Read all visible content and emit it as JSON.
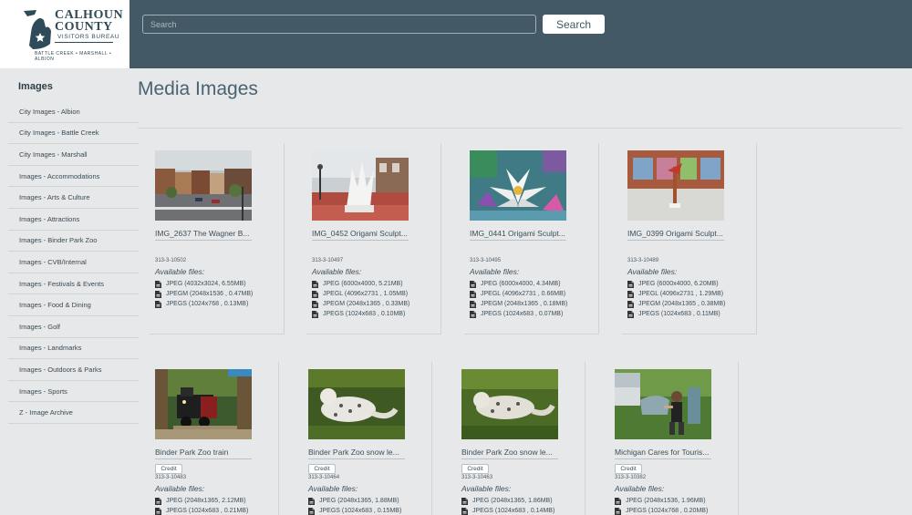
{
  "logo": {
    "line1": "CALHOUN",
    "line2": "COUNTY",
    "sub": "VISITORS BUREAU",
    "towns": "BATTLE CREEK • MARSHALL • ALBION"
  },
  "search": {
    "placeholder": "Search",
    "button_label": "Search"
  },
  "sidebar": {
    "heading": "Images",
    "items": [
      {
        "label": "City Images - Albion"
      },
      {
        "label": "City Images - Battle Creek"
      },
      {
        "label": "City Images - Marshall"
      },
      {
        "label": "Images - Accommodations"
      },
      {
        "label": "Images - Arts & Culture"
      },
      {
        "label": "Images - Attractions"
      },
      {
        "label": "Images - Binder Park Zoo"
      },
      {
        "label": "Images - CVB/Internal"
      },
      {
        "label": "Images - Festivals & Events"
      },
      {
        "label": "Images - Food & Dining"
      },
      {
        "label": "Images - Golf"
      },
      {
        "label": "Images - Landmarks"
      },
      {
        "label": "Images - Outdoors & Parks"
      },
      {
        "label": "Images - Sports"
      },
      {
        "label": "Z - Image Archive"
      }
    ]
  },
  "main": {
    "title": "Media Images",
    "available_label": "Available files:",
    "credit_label": "Credit",
    "icons": {
      "file": "file-icon"
    },
    "cards": [
      {
        "title": "IMG_2637 The Wagner B...",
        "id": "313-3-10502",
        "credit": false,
        "image": "street-scene",
        "files": [
          "JPEG (4032x3024, 6.55MB)",
          "JPEGM (2048x1536 , 0.47MB)",
          "JPEGS (1024x768 , 0.13MB)"
        ]
      },
      {
        "title": "IMG_0452 Origami Sculpt...",
        "id": "313-3-10497",
        "credit": false,
        "image": "white-sculpture",
        "files": [
          "JPEG (6000x4000, 5.21MB)",
          "JPEGL (4096x2731 , 1.05MB)",
          "JPEGM (2048x1365 , 0.33MB)",
          "JPEGS (1024x683 , 0.10MB)"
        ]
      },
      {
        "title": "IMG_0441 Origami Sculpt...",
        "id": "313-3-10495",
        "credit": false,
        "image": "lotus-sculpture",
        "files": [
          "JPEG (6000x4000, 4.34MB)",
          "JPEGL (4096x2731 , 0.66MB)",
          "JPEGM (2048x1365 , 0.18MB)",
          "JPEGS (1024x683 , 0.07MB)"
        ]
      },
      {
        "title": "IMG_0399 Origami Sculpt...",
        "id": "313-3-10489",
        "credit": false,
        "image": "storefront-sculpture",
        "files": [
          "JPEG (6000x4000, 6.20MB)",
          "JPEGL (4096x2731 , 1.29MB)",
          "JPEGM (2048x1365 , 0.38MB)",
          "JPEGS (1024x683 , 0.11MB)"
        ]
      },
      {
        "title": "Binder Park Zoo train",
        "id": "313-3-10483",
        "credit": true,
        "image": "zoo-train",
        "files": [
          "JPEG (2048x1365, 2.12MB)",
          "JPEGS (1024x683 , 0.21MB)"
        ]
      },
      {
        "title": "Binder Park Zoo snow le...",
        "id": "313-3-10464",
        "credit": true,
        "image": "snow-leopard-1",
        "files": [
          "JPEG (2048x1365, 1.88MB)",
          "JPEGS (1024x683 , 0.15MB)"
        ]
      },
      {
        "title": "Binder Park Zoo snow le...",
        "id": "313-3-10463",
        "credit": true,
        "image": "snow-leopard-2",
        "files": [
          "JPEG (2048x1365, 1.86MB)",
          "JPEGS (1024x683 , 0.14MB)"
        ]
      },
      {
        "title": "Michigan Cares for Touris...",
        "id": "313-3-10382",
        "credit": true,
        "image": "woman-painting",
        "files": [
          "JPEG (2048x1536, 1.96MB)",
          "JPEGS (1024x768 , 0.20MB)"
        ]
      }
    ]
  }
}
